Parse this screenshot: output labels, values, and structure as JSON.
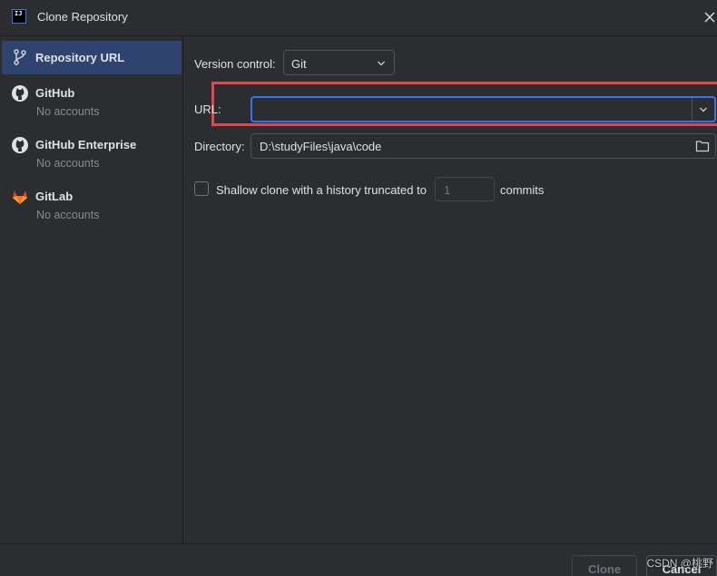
{
  "window": {
    "title": "Clone Repository",
    "app_icon_text": "IJ"
  },
  "sidebar": {
    "items": [
      {
        "label": "Repository URL",
        "subtitle": "",
        "icon": "git-branch-icon",
        "selected": true
      },
      {
        "label": "GitHub",
        "subtitle": "No accounts",
        "icon": "github-icon",
        "selected": false
      },
      {
        "label": "GitHub Enterprise",
        "subtitle": "No accounts",
        "icon": "github-icon",
        "selected": false
      },
      {
        "label": "GitLab",
        "subtitle": "No accounts",
        "icon": "gitlab-icon",
        "selected": false
      }
    ]
  },
  "form": {
    "version_control_label": "Version control:",
    "version_control_value": "Git",
    "url_label": "URL:",
    "url_value": "",
    "directory_label": "Directory:",
    "directory_value": "D:\\studyFiles\\java\\code",
    "shallow_clone_label": "Shallow clone with a history truncated to",
    "shallow_clone_checked": false,
    "commits_value": "1",
    "commits_label": "commits"
  },
  "footer": {
    "clone_label": "Clone",
    "cancel_label": "Cancel",
    "watermark": "CSDN @桃野"
  },
  "colors": {
    "background": "#2b2d30",
    "selection": "#2e436e",
    "focus_border": "#3574f0",
    "highlight_annotation": "#e0474d",
    "gitlab_orange": "#e24329"
  }
}
